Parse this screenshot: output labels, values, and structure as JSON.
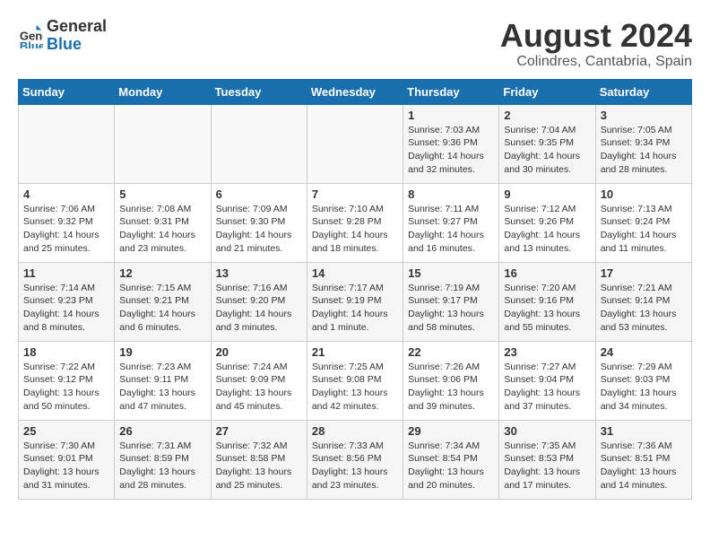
{
  "header": {
    "logo_line1": "General",
    "logo_line2": "Blue",
    "month_year": "August 2024",
    "location": "Colindres, Cantabria, Spain"
  },
  "weekdays": [
    "Sunday",
    "Monday",
    "Tuesday",
    "Wednesday",
    "Thursday",
    "Friday",
    "Saturday"
  ],
  "weeks": [
    [
      {
        "day": "",
        "info": ""
      },
      {
        "day": "",
        "info": ""
      },
      {
        "day": "",
        "info": ""
      },
      {
        "day": "",
        "info": ""
      },
      {
        "day": "1",
        "info": "Sunrise: 7:03 AM\nSunset: 9:36 PM\nDaylight: 14 hours\nand 32 minutes."
      },
      {
        "day": "2",
        "info": "Sunrise: 7:04 AM\nSunset: 9:35 PM\nDaylight: 14 hours\nand 30 minutes."
      },
      {
        "day": "3",
        "info": "Sunrise: 7:05 AM\nSunset: 9:34 PM\nDaylight: 14 hours\nand 28 minutes."
      }
    ],
    [
      {
        "day": "4",
        "info": "Sunrise: 7:06 AM\nSunset: 9:32 PM\nDaylight: 14 hours\nand 25 minutes."
      },
      {
        "day": "5",
        "info": "Sunrise: 7:08 AM\nSunset: 9:31 PM\nDaylight: 14 hours\nand 23 minutes."
      },
      {
        "day": "6",
        "info": "Sunrise: 7:09 AM\nSunset: 9:30 PM\nDaylight: 14 hours\nand 21 minutes."
      },
      {
        "day": "7",
        "info": "Sunrise: 7:10 AM\nSunset: 9:28 PM\nDaylight: 14 hours\nand 18 minutes."
      },
      {
        "day": "8",
        "info": "Sunrise: 7:11 AM\nSunset: 9:27 PM\nDaylight: 14 hours\nand 16 minutes."
      },
      {
        "day": "9",
        "info": "Sunrise: 7:12 AM\nSunset: 9:26 PM\nDaylight: 14 hours\nand 13 minutes."
      },
      {
        "day": "10",
        "info": "Sunrise: 7:13 AM\nSunset: 9:24 PM\nDaylight: 14 hours\nand 11 minutes."
      }
    ],
    [
      {
        "day": "11",
        "info": "Sunrise: 7:14 AM\nSunset: 9:23 PM\nDaylight: 14 hours\nand 8 minutes."
      },
      {
        "day": "12",
        "info": "Sunrise: 7:15 AM\nSunset: 9:21 PM\nDaylight: 14 hours\nand 6 minutes."
      },
      {
        "day": "13",
        "info": "Sunrise: 7:16 AM\nSunset: 9:20 PM\nDaylight: 14 hours\nand 3 minutes."
      },
      {
        "day": "14",
        "info": "Sunrise: 7:17 AM\nSunset: 9:19 PM\nDaylight: 14 hours\nand 1 minute."
      },
      {
        "day": "15",
        "info": "Sunrise: 7:19 AM\nSunset: 9:17 PM\nDaylight: 13 hours\nand 58 minutes."
      },
      {
        "day": "16",
        "info": "Sunrise: 7:20 AM\nSunset: 9:16 PM\nDaylight: 13 hours\nand 55 minutes."
      },
      {
        "day": "17",
        "info": "Sunrise: 7:21 AM\nSunset: 9:14 PM\nDaylight: 13 hours\nand 53 minutes."
      }
    ],
    [
      {
        "day": "18",
        "info": "Sunrise: 7:22 AM\nSunset: 9:12 PM\nDaylight: 13 hours\nand 50 minutes."
      },
      {
        "day": "19",
        "info": "Sunrise: 7:23 AM\nSunset: 9:11 PM\nDaylight: 13 hours\nand 47 minutes."
      },
      {
        "day": "20",
        "info": "Sunrise: 7:24 AM\nSunset: 9:09 PM\nDaylight: 13 hours\nand 45 minutes."
      },
      {
        "day": "21",
        "info": "Sunrise: 7:25 AM\nSunset: 9:08 PM\nDaylight: 13 hours\nand 42 minutes."
      },
      {
        "day": "22",
        "info": "Sunrise: 7:26 AM\nSunset: 9:06 PM\nDaylight: 13 hours\nand 39 minutes."
      },
      {
        "day": "23",
        "info": "Sunrise: 7:27 AM\nSunset: 9:04 PM\nDaylight: 13 hours\nand 37 minutes."
      },
      {
        "day": "24",
        "info": "Sunrise: 7:29 AM\nSunset: 9:03 PM\nDaylight: 13 hours\nand 34 minutes."
      }
    ],
    [
      {
        "day": "25",
        "info": "Sunrise: 7:30 AM\nSunset: 9:01 PM\nDaylight: 13 hours\nand 31 minutes."
      },
      {
        "day": "26",
        "info": "Sunrise: 7:31 AM\nSunset: 8:59 PM\nDaylight: 13 hours\nand 28 minutes."
      },
      {
        "day": "27",
        "info": "Sunrise: 7:32 AM\nSunset: 8:58 PM\nDaylight: 13 hours\nand 25 minutes."
      },
      {
        "day": "28",
        "info": "Sunrise: 7:33 AM\nSunset: 8:56 PM\nDaylight: 13 hours\nand 23 minutes."
      },
      {
        "day": "29",
        "info": "Sunrise: 7:34 AM\nSunset: 8:54 PM\nDaylight: 13 hours\nand 20 minutes."
      },
      {
        "day": "30",
        "info": "Sunrise: 7:35 AM\nSunset: 8:53 PM\nDaylight: 13 hours\nand 17 minutes."
      },
      {
        "day": "31",
        "info": "Sunrise: 7:36 AM\nSunset: 8:51 PM\nDaylight: 13 hours\nand 14 minutes."
      }
    ]
  ]
}
